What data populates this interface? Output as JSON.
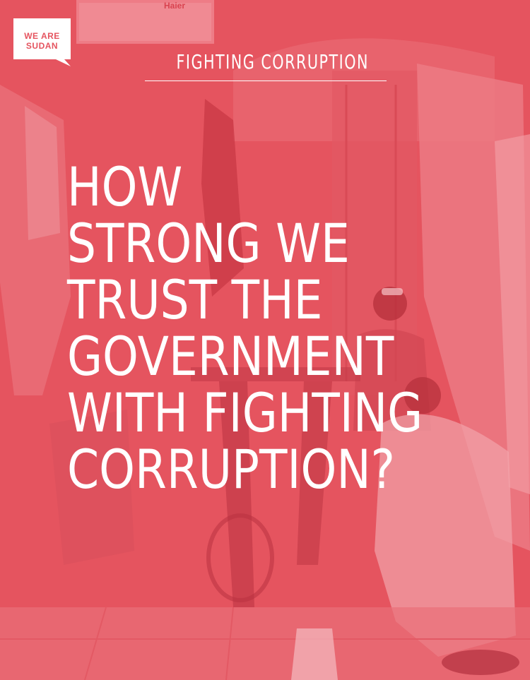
{
  "logo": {
    "line1": "WE ARE",
    "line2": "SUDAN"
  },
  "background_photo": {
    "ac_brand": "Haier"
  },
  "kicker": "FIGHTING CORRUPTION",
  "headline": {
    "lines": [
      "HOW",
      "STRONG WE",
      "TRUST THE",
      "GOVERNMENT",
      "WITH FIGHTING",
      "CORRUPTION?"
    ]
  },
  "colors": {
    "overlay": "#e5545f",
    "text": "#ffffff"
  }
}
